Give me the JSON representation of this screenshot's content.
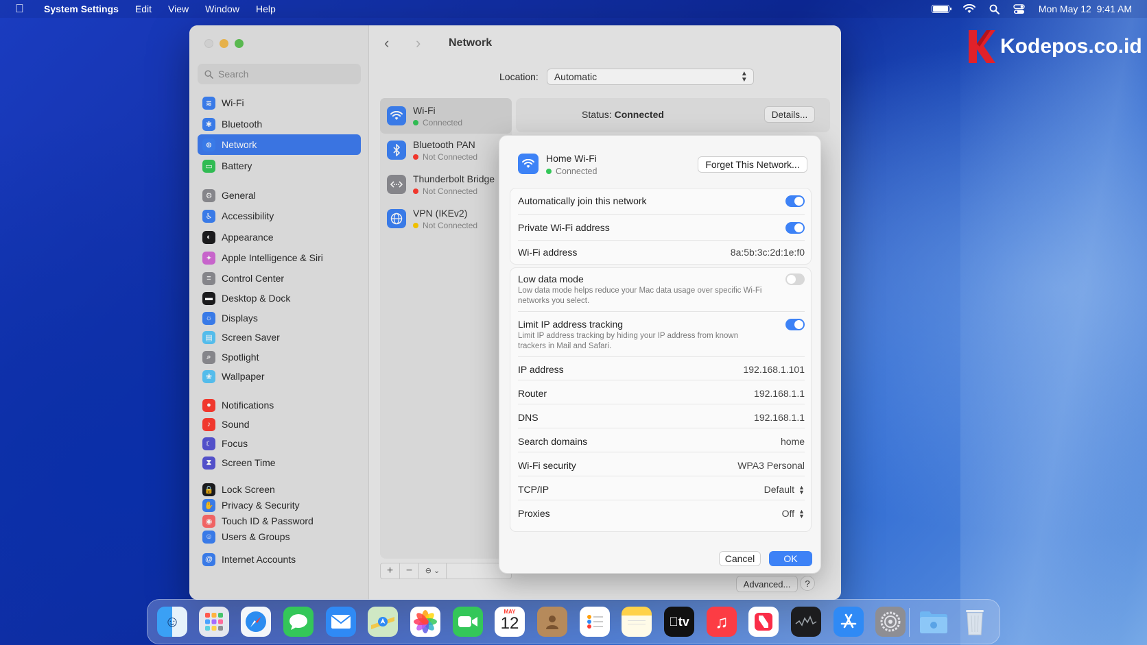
{
  "menubar": {
    "app": "System Settings",
    "items": [
      "Edit",
      "View",
      "Window",
      "Help"
    ],
    "clock": "Mon May 12  9:41 AM"
  },
  "watermark": {
    "text": "Kodepos.co.id"
  },
  "sidebar": {
    "search_placeholder": "Search",
    "items": [
      {
        "label": "Wi-Fi",
        "color": "#3d82f6"
      },
      {
        "label": "Bluetooth",
        "color": "#3d82f6"
      },
      {
        "label": "Network",
        "color": "#3d82f6"
      },
      {
        "label": "Battery",
        "color": "#34c759"
      },
      {
        "label": "General",
        "color": "#8e8e93"
      },
      {
        "label": "Accessibility",
        "color": "#3d82f6"
      },
      {
        "label": "Appearance",
        "color": "#1d1d1f"
      },
      {
        "label": "Apple Intelligence & Siri",
        "color": "#d46bd8"
      },
      {
        "label": "Control Center",
        "color": "#8e8e93"
      },
      {
        "label": "Desktop & Dock",
        "color": "#1d1d1f"
      },
      {
        "label": "Displays",
        "color": "#3d82f6"
      },
      {
        "label": "Screen Saver",
        "color": "#5ac8fa"
      },
      {
        "label": "Spotlight",
        "color": "#8e8e93"
      },
      {
        "label": "Wallpaper",
        "color": "#5ac8fa"
      },
      {
        "label": "Notifications",
        "color": "#ff3b30"
      },
      {
        "label": "Sound",
        "color": "#ff3b30"
      },
      {
        "label": "Focus",
        "color": "#5856d6"
      },
      {
        "label": "Screen Time",
        "color": "#5856d6"
      },
      {
        "label": "Lock Screen",
        "color": "#1d1d1f"
      },
      {
        "label": "Privacy & Security",
        "color": "#3d82f6"
      },
      {
        "label": "Touch ID & Password",
        "color": "#ff6b6b"
      },
      {
        "label": "Users & Groups",
        "color": "#3d82f6"
      },
      {
        "label": "Internet Accounts",
        "color": "#3d82f6"
      }
    ]
  },
  "main": {
    "title": "Network",
    "location_label": "Location:",
    "location_value": "Automatic",
    "status_label": "Status:",
    "status_value": "Connected",
    "details_button": "Details...",
    "advanced_button": "Advanced...",
    "help_button": "?",
    "services": [
      {
        "name": "Wi-Fi",
        "status": "Connected",
        "dot": "#34c759"
      },
      {
        "name": "Bluetooth PAN",
        "status": "Not Connected",
        "dot": "#ff3b30"
      },
      {
        "name": "Thunderbolt Bridge",
        "status": "Not Connected",
        "dot": "#ff3b30"
      },
      {
        "name": "VPN (IKEv2)",
        "status": "Not Connected",
        "dot": "#ffcc00"
      }
    ],
    "service_tools": [
      "+",
      "−",
      "⊖ ⌄"
    ]
  },
  "sheet": {
    "network_name": "Home Wi-Fi",
    "network_status": "Connected",
    "forget_button": "Forget This Network...",
    "auto_join": {
      "label": "Automatically join this network",
      "on": true
    },
    "private_address": {
      "label": "Private Wi-Fi address",
      "on": true
    },
    "wifi_address": {
      "label": "Wi-Fi address",
      "value": "8a:5b:3c:2d:1e:f0"
    },
    "low_data": {
      "label": "Low data mode",
      "desc": "Low data mode helps reduce your Mac data usage over specific Wi-Fi networks you select.",
      "on": false
    },
    "limit_ip": {
      "label": "Limit IP address tracking",
      "desc": "Limit IP address tracking by hiding your IP address from known trackers in Mail and Safari.",
      "on": true
    },
    "ip_address": {
      "label": "IP address",
      "value": "192.168.1.101"
    },
    "router": {
      "label": "Router",
      "value": "192.168.1.1"
    },
    "dns": {
      "label": "DNS",
      "value": "192.168.1.1"
    },
    "search_domains": {
      "label": "Search domains",
      "value": "home"
    },
    "security": {
      "label": "Wi-Fi security",
      "value": "WPA3 Personal"
    },
    "tcpip": {
      "label": "TCP/IP",
      "value": "Default"
    },
    "proxies": {
      "label": "Proxies",
      "value": "Off"
    },
    "cancel": "Cancel",
    "ok": "OK"
  },
  "dock": {
    "calendar_month": "MAY",
    "calendar_day": "12",
    "tv_label": "tv"
  },
  "colors": {
    "accent": "#3d82f6",
    "selected": "#3e7cf0"
  }
}
